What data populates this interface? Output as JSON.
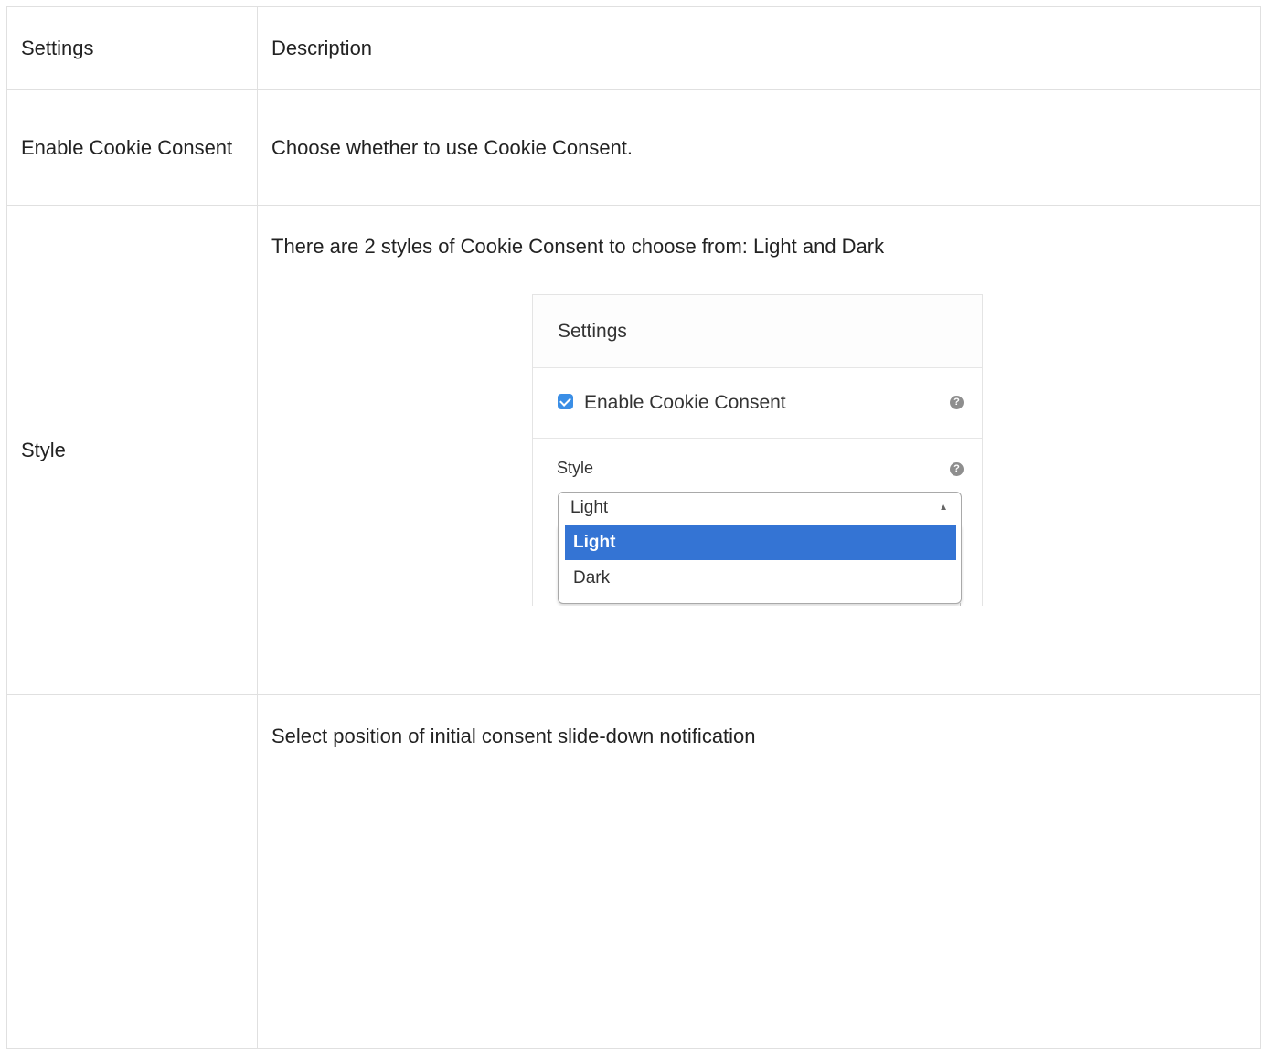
{
  "table": {
    "header": {
      "settings": "Settings",
      "description": "Description"
    },
    "rows": [
      {
        "setting": "Enable Cookie Consent",
        "description": "Choose whether to use Cookie Consent."
      },
      {
        "setting": "Style",
        "description": "There are 2 styles of Cookie Consent to choose from: Light and Dark"
      },
      {
        "setting": "",
        "description": "Select position of initial consent slide-down notification"
      }
    ]
  },
  "embedded_panel": {
    "title": "Settings",
    "enable_label": "Enable Cookie Consent",
    "enable_checked": true,
    "help_glyph": "?",
    "style_label": "Style",
    "select_value": "Light",
    "select_arrow": "▲",
    "options": [
      "Light",
      "Dark"
    ],
    "selected_option": "Light",
    "colors": {
      "checkbox": "#3a8ee6",
      "highlight": "#3474d4"
    }
  }
}
